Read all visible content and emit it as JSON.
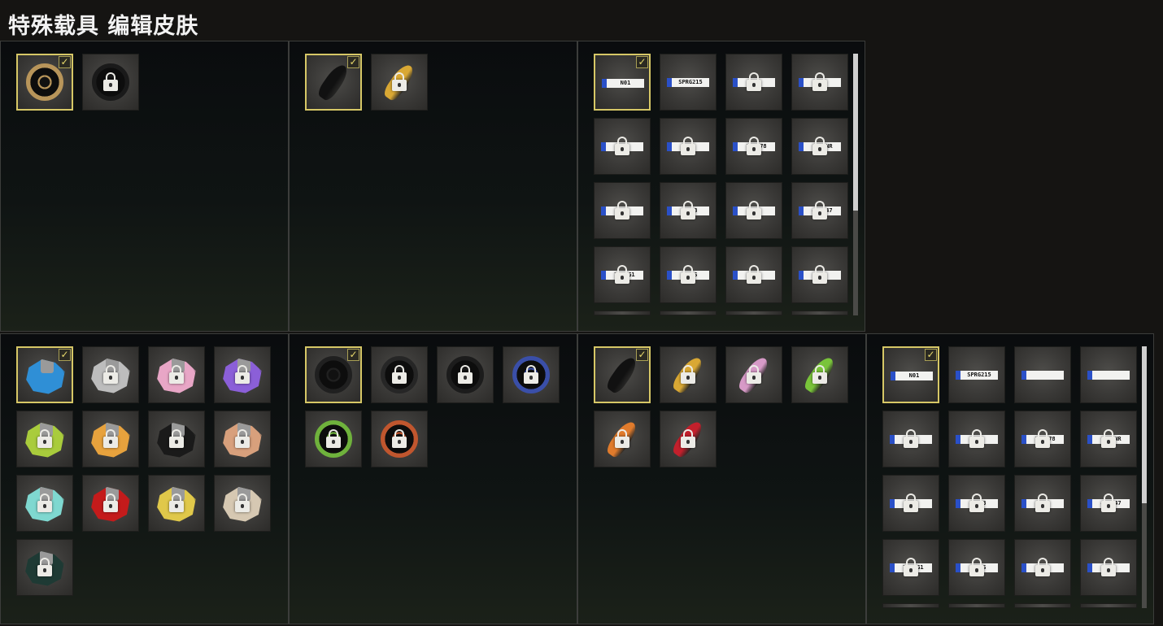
{
  "page": {
    "title": "特殊载具 编辑皮肤"
  },
  "colors": {
    "selected_border": "#d6c766",
    "checkmark": "#e8d96b",
    "plate_blue": "#2a50c8"
  },
  "top_row": {
    "wheels": [
      {
        "icon": "gold-rim-wheel-icon",
        "selected": true,
        "locked": false
      },
      {
        "icon": "black-rim-wheel-icon",
        "selected": false,
        "locked": true
      }
    ],
    "calipers": [
      {
        "icon": "black-caliper-icon",
        "selected": true,
        "locked": false
      },
      {
        "icon": "gold-caliper-icon",
        "selected": false,
        "locked": true
      }
    ],
    "plates": [
      {
        "text": "N01",
        "selected": true,
        "locked": false
      },
      {
        "text": "SPRG215",
        "selected": false,
        "locked": false
      },
      {
        "text": "",
        "selected": false,
        "locked": true
      },
      {
        "text": "",
        "selected": false,
        "locked": true
      },
      {
        "text": "",
        "selected": false,
        "locked": true
      },
      {
        "text": "",
        "selected": false,
        "locked": true
      },
      {
        "text": "12 678",
        "selected": false,
        "locked": true
      },
      {
        "text": "CH DNR",
        "selected": false,
        "locked": true
      },
      {
        "text": "D",
        "selected": false,
        "locked": true
      },
      {
        "text": "R N3",
        "selected": false,
        "locked": true
      },
      {
        "text": "1",
        "selected": false,
        "locked": true
      },
      {
        "text": "47 147",
        "selected": false,
        "locked": true
      },
      {
        "text": "TY 0G1",
        "selected": false,
        "locked": true
      },
      {
        "text": "C RS",
        "selected": false,
        "locked": true
      },
      {
        "text": "",
        "selected": false,
        "locked": true
      },
      {
        "text": "G",
        "selected": false,
        "locked": true
      }
    ]
  },
  "bottom_row": {
    "paints": [
      {
        "icon": "blue-paint-icon",
        "color": "#2f8fd6",
        "selected": true,
        "locked": false
      },
      {
        "icon": "silver-paint-icon",
        "color": "#bdbdbd",
        "selected": false,
        "locked": true
      },
      {
        "icon": "pink-paint-icon",
        "color": "#e8a6c6",
        "selected": false,
        "locked": true
      },
      {
        "icon": "purple-paint-icon",
        "color": "#8b5fd8",
        "selected": false,
        "locked": true
      },
      {
        "icon": "lime-paint-icon",
        "color": "#a9cc3c",
        "selected": false,
        "locked": true
      },
      {
        "icon": "orange-paint-icon",
        "color": "#e7a23d",
        "selected": false,
        "locked": true
      },
      {
        "icon": "black-paint-icon",
        "color": "#1a1a1a",
        "selected": false,
        "locked": true
      },
      {
        "icon": "peach-paint-icon",
        "color": "#d8a07c",
        "selected": false,
        "locked": true
      },
      {
        "icon": "teal-paint-icon",
        "color": "#7fd8d0",
        "selected": false,
        "locked": true
      },
      {
        "icon": "red-paint-icon",
        "color": "#c41b1b",
        "selected": false,
        "locked": true
      },
      {
        "icon": "yellow-paint-icon",
        "color": "#e0c84a",
        "selected": false,
        "locked": true
      },
      {
        "icon": "champagne-paint-icon",
        "color": "#d6c8b2",
        "selected": false,
        "locked": true
      },
      {
        "icon": "dark-green-paint-icon",
        "color": "#1e3a34",
        "selected": false,
        "locked": true
      }
    ],
    "wheels": [
      {
        "icon": "black-spoke-wheel-icon",
        "color": "#202020",
        "selected": true,
        "locked": false
      },
      {
        "icon": "gloss-black-wheel-icon",
        "color": "#262626",
        "selected": false,
        "locked": true
      },
      {
        "icon": "matte-black-wheel-icon",
        "color": "#1c1c1c",
        "selected": false,
        "locked": true
      },
      {
        "icon": "blue-mesh-wheel-icon",
        "color": "#3a4fa8",
        "selected": false,
        "locked": true
      },
      {
        "icon": "green-mesh-wheel-icon",
        "color": "#6fb23c",
        "selected": false,
        "locked": true
      },
      {
        "icon": "copper-mesh-wheel-icon",
        "color": "#c0562e",
        "selected": false,
        "locked": true
      }
    ],
    "calipers": [
      {
        "icon": "black-caliper-icon",
        "color": "#111111",
        "selected": true,
        "locked": false
      },
      {
        "icon": "gold-caliper-icon",
        "color": "#d9a834",
        "selected": false,
        "locked": true
      },
      {
        "icon": "pink-caliper-icon",
        "color": "#d79ac7",
        "selected": false,
        "locked": true
      },
      {
        "icon": "green-caliper-icon",
        "color": "#79c43a",
        "selected": false,
        "locked": true
      },
      {
        "icon": "orange-caliper-icon",
        "color": "#e07b2c",
        "selected": false,
        "locked": true
      },
      {
        "icon": "red-caliper-icon",
        "color": "#c3202c",
        "selected": false,
        "locked": true
      }
    ],
    "plates": [
      {
        "text": "N01",
        "selected": true,
        "locked": false
      },
      {
        "text": "SPRG215",
        "selected": false,
        "locked": false
      },
      {
        "text": "",
        "selected": false,
        "locked": false
      },
      {
        "text": "",
        "selected": false,
        "locked": false
      },
      {
        "text": "",
        "selected": false,
        "locked": true
      },
      {
        "text": "",
        "selected": false,
        "locked": true
      },
      {
        "text": "12 678",
        "selected": false,
        "locked": true
      },
      {
        "text": "CH DNR",
        "selected": false,
        "locked": true
      },
      {
        "text": "D",
        "selected": false,
        "locked": true
      },
      {
        "text": "R N3",
        "selected": false,
        "locked": true
      },
      {
        "text": "1",
        "selected": false,
        "locked": true
      },
      {
        "text": "47 147",
        "selected": false,
        "locked": true
      },
      {
        "text": "TY 0G1",
        "selected": false,
        "locked": true
      },
      {
        "text": "C RS",
        "selected": false,
        "locked": true
      },
      {
        "text": "",
        "selected": false,
        "locked": true
      },
      {
        "text": "G",
        "selected": false,
        "locked": true
      }
    ]
  }
}
